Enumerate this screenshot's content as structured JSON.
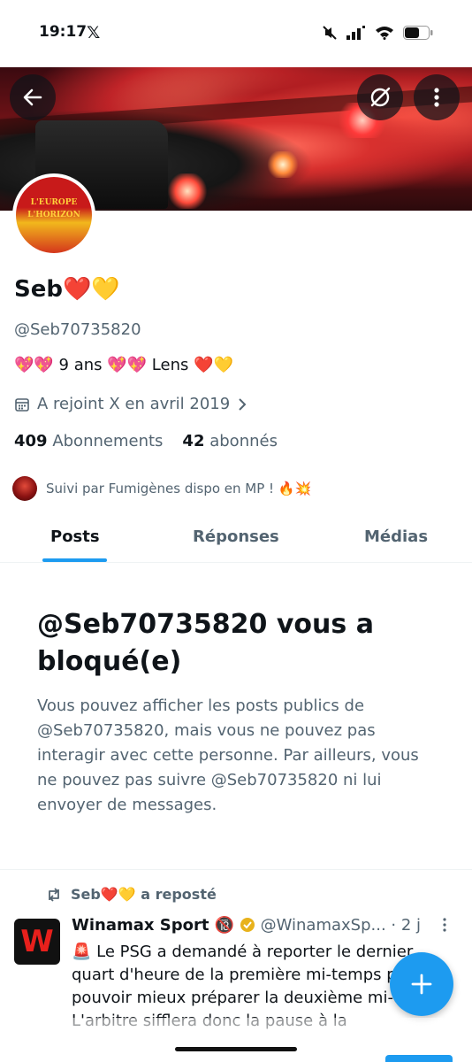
{
  "status_bar": {
    "time": "19:17",
    "app_glyph": "𝕏"
  },
  "profile": {
    "name": "Seb❤️💛",
    "handle": "@Seb70735820",
    "bio": "💖💖 9 ans 💖💖  Lens ❤️💛",
    "joined": "A rejoint X en avril 2019",
    "following_count": "409",
    "following_label": "Abonnements",
    "followers_count": "42",
    "followers_label": "abonnés",
    "followed_by": "Suivi par Fumigènes dispo en MP ! 🔥💥",
    "avatar_text_line1": "L'EUROPE",
    "avatar_text_line2": "L'HORIZON"
  },
  "tabs": [
    {
      "label": "Posts",
      "active": true
    },
    {
      "label": "Réponses",
      "active": false
    },
    {
      "label": "Médias",
      "active": false
    }
  ],
  "blocked_notice": {
    "title": "@Seb70735820 vous a bloqué(e)",
    "body": "Vous pouvez afficher les posts publics de @Seb70735820, mais vous ne pouvez pas interagir avec cette personne. Par ailleurs, vous ne pouvez pas suivre @Seb70735820 ni lui envoyer de messages."
  },
  "tweet": {
    "repost_by": "Seb❤️💛 a reposté",
    "author_name": "Winamax Sport 🔞",
    "author_handle": "@WinamaxSp...",
    "time": "· 2 j",
    "avatar_letter": "W",
    "text": "🚨 Le PSG a demandé à reporter le dernier quart d'heure de la première mi-temps pour pouvoir mieux préparer la deuxième mi-temps. L'arbitre sifflera donc la pause à la"
  },
  "colors": {
    "accent": "#1d9bf0",
    "secondary_text": "#536471",
    "primary_text": "#0f1419",
    "verified_badge": "#e8b21c"
  },
  "icons": {
    "back": "arrow-left-icon",
    "grok": "grok-icon",
    "more": "more-vertical-icon",
    "calendar": "calendar-icon",
    "repost": "repost-icon",
    "compose": "plus-icon"
  }
}
